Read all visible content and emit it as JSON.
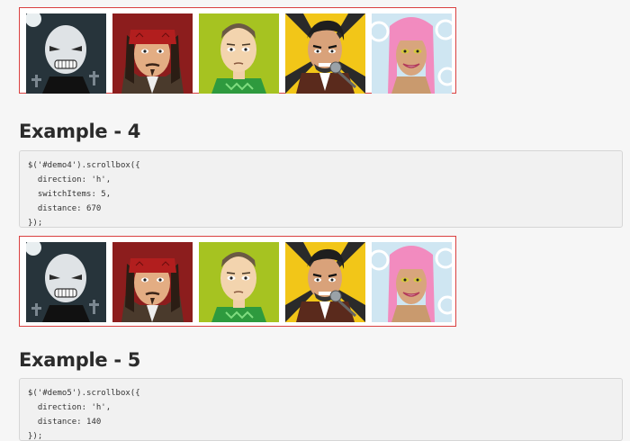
{
  "galleries": [
    {
      "name": "demo3",
      "items": [
        "Skull-face avatar",
        "Bandana pirate avatar",
        "Bald man avatar",
        "Singer with microphone avatar",
        "Pink hair avatar"
      ]
    },
    {
      "name": "demo4",
      "items": [
        "Skull-face avatar",
        "Bandana pirate avatar",
        "Bald man avatar",
        "Singer with microphone avatar",
        "Pink hair avatar"
      ]
    }
  ],
  "examples": [
    {
      "title": "Example - 4",
      "code": [
        "$('#demo4').scrollbox({",
        "  direction: 'h',",
        "  switchItems: 5,",
        "  distance: 670",
        "});"
      ]
    },
    {
      "title": "Example - 5",
      "code": [
        "$('#demo5').scrollbox({",
        "  direction: 'h',",
        "  distance: 140",
        "});"
      ]
    }
  ],
  "colors": {
    "border": "#d94040",
    "heading": "#2b2b2b",
    "code_bg": "#f1f1f1"
  }
}
